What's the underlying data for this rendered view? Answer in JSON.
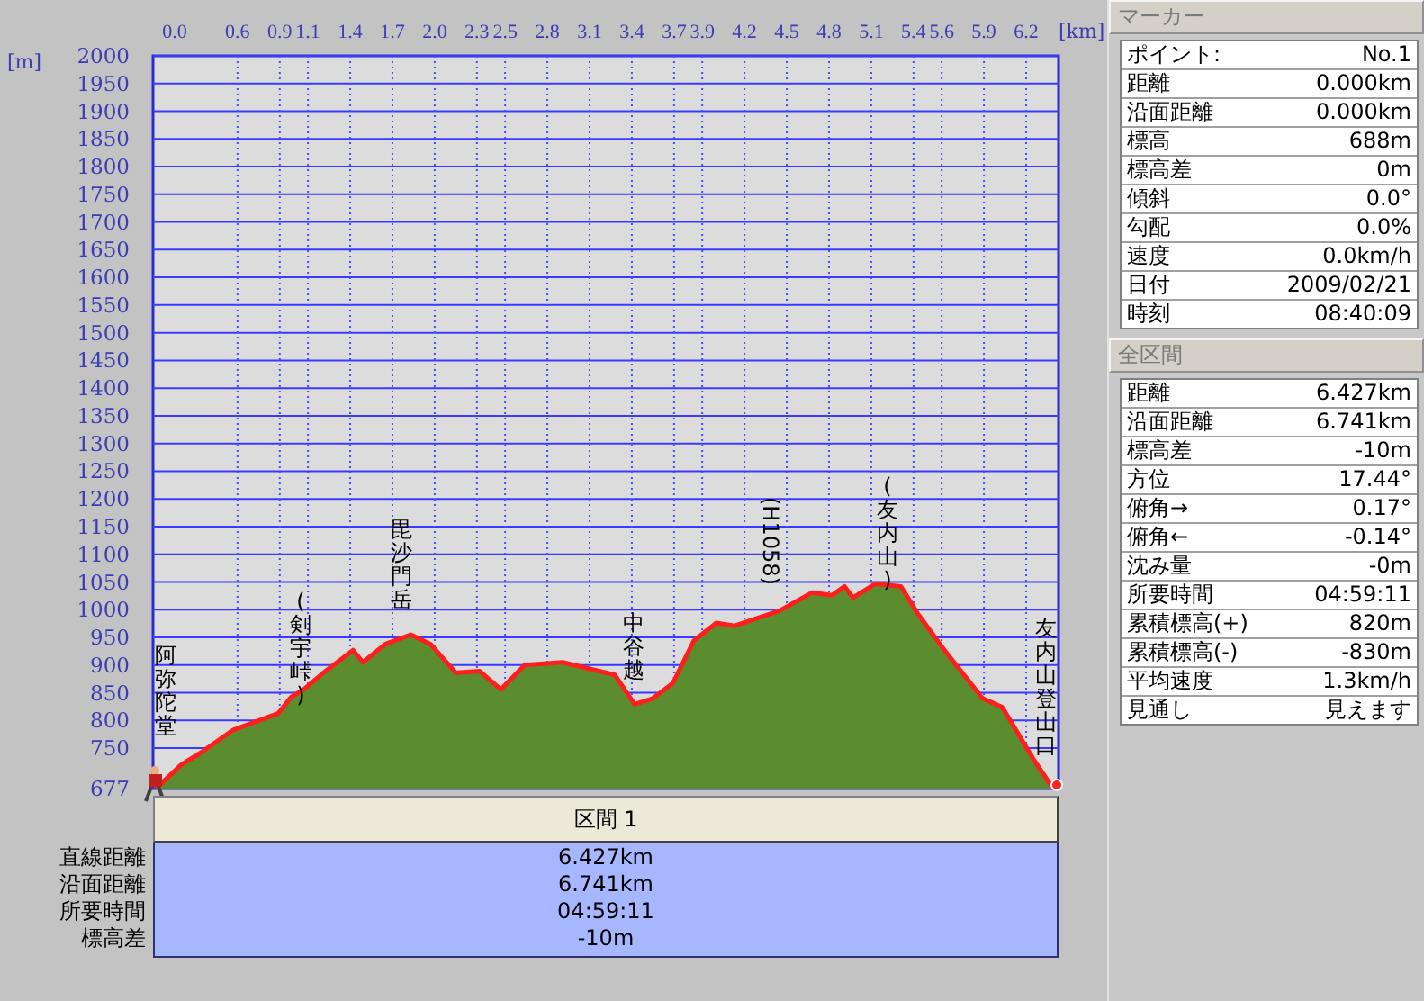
{
  "chart": {
    "chart_data": {
      "type": "area",
      "xlabel": "[km]",
      "ylabel": "[m]",
      "xlim": [
        0,
        6.43
      ],
      "ylim": [
        677,
        2000
      ],
      "xticks": [
        {
          "value": 0,
          "label": "0.0"
        },
        {
          "value": 0.6,
          "label": "0.6"
        },
        {
          "value": 0.9,
          "label": "0.9"
        },
        {
          "value": 1.1,
          "label": "1.1"
        },
        {
          "value": 1.4,
          "label": "1.4"
        },
        {
          "value": 1.7,
          "label": "1.7"
        },
        {
          "value": 2.0,
          "label": "2.0"
        },
        {
          "value": 2.3,
          "label": "2.3"
        },
        {
          "value": 2.5,
          "label": "2.5"
        },
        {
          "value": 2.8,
          "label": "2.8"
        },
        {
          "value": 3.1,
          "label": "3.1"
        },
        {
          "value": 3.4,
          "label": "3.4"
        },
        {
          "value": 3.7,
          "label": "3.7"
        },
        {
          "value": 3.9,
          "label": "3.9"
        },
        {
          "value": 4.2,
          "label": "4.2"
        },
        {
          "value": 4.5,
          "label": "4.5"
        },
        {
          "value": 4.8,
          "label": "4.8"
        },
        {
          "value": 5.1,
          "label": "5.1"
        },
        {
          "value": 5.4,
          "label": "5.4"
        },
        {
          "value": 5.6,
          "label": "5.6"
        },
        {
          "value": 5.9,
          "label": "5.9"
        },
        {
          "value": 6.2,
          "label": "6.2"
        }
      ],
      "yticks": [
        677,
        750,
        800,
        850,
        900,
        950,
        1000,
        1050,
        1100,
        1150,
        1200,
        1250,
        1300,
        1350,
        1400,
        1450,
        1500,
        1550,
        1600,
        1650,
        1700,
        1750,
        1800,
        1850,
        1900,
        1950,
        2000
      ],
      "x": [
        0.02,
        0.2,
        0.34,
        0.57,
        0.89,
        0.98,
        1.07,
        1.2,
        1.42,
        1.49,
        1.65,
        1.83,
        1.97,
        2.15,
        2.32,
        2.47,
        2.64,
        2.91,
        3.28,
        3.42,
        3.55,
        3.69,
        3.84,
        4.0,
        4.13,
        4.45,
        4.68,
        4.82,
        4.91,
        4.97,
        5.13,
        5.31,
        5.43,
        5.62,
        5.89,
        6.03,
        6.25,
        6.39
      ],
      "grid": true,
      "series": [
        {
          "color": "#5b8c2e",
          "values": [
            677,
            720,
            742,
            783,
            813,
            842,
            856,
            884,
            927,
            905,
            938,
            955,
            938,
            886,
            889,
            856,
            900,
            905,
            882,
            829,
            840,
            867,
            944,
            976,
            971,
            998,
            1031,
            1026,
            1042,
            1022,
            1047,
            1042,
            993,
            927,
            840,
            824,
            731,
            677
          ]
        }
      ],
      "annotations": [
        "阿弥陀堂",
        "(剣宇峠)",
        "毘沙門岳",
        "中谷越",
        "(H1058)",
        "(友内山)",
        "友内山登山口"
      ]
    }
  },
  "segment_table": {
    "header": "区間 1",
    "rows": [
      {
        "label": "直線距離",
        "value": "6.427km"
      },
      {
        "label": "沿面距離",
        "value": "6.741km"
      },
      {
        "label": "所要時間",
        "value": "04:59:11"
      },
      {
        "label": "標高差",
        "value": "-10m"
      }
    ]
  },
  "marker_panel": {
    "title": "マーカー",
    "rows": [
      {
        "label": "ポイント:",
        "value": "No.1"
      },
      {
        "label": "距離",
        "value": "0.000km"
      },
      {
        "label": "沿面距離",
        "value": "0.000km"
      },
      {
        "label": "標高",
        "value": "688m"
      },
      {
        "label": "標高差",
        "value": "0m"
      },
      {
        "label": "傾斜",
        "value": "0.0°"
      },
      {
        "label": "勾配",
        "value": "0.0%"
      },
      {
        "label": "速度",
        "value": "0.0km/h"
      },
      {
        "label": "日付",
        "value": "2009/02/21"
      },
      {
        "label": "時刻",
        "value": "08:40:09"
      }
    ]
  },
  "total_panel": {
    "title": "全区間",
    "rows": [
      {
        "label": "距離",
        "value": "6.427km"
      },
      {
        "label": "沿面距離",
        "value": "6.741km"
      },
      {
        "label": "標高差",
        "value": "-10m"
      },
      {
        "label": "方位",
        "value": "17.44°"
      },
      {
        "label": "俯角→",
        "value": "0.17°"
      },
      {
        "label": "俯角←",
        "value": "-0.14°"
      },
      {
        "label": "沈み量",
        "value": "-0m"
      },
      {
        "label": "所要時間",
        "value": "04:59:11"
      },
      {
        "label": "累積標高(+)",
        "value": "820m"
      },
      {
        "label": "累積標高(-)",
        "value": "-830m"
      },
      {
        "label": "平均速度",
        "value": "1.3km/h"
      },
      {
        "label": "見通し",
        "value": "見えます"
      }
    ]
  }
}
